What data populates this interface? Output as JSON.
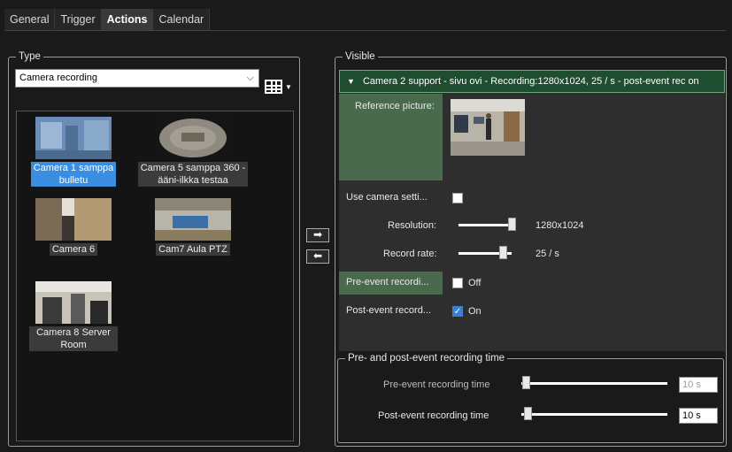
{
  "tabs": [
    "General",
    "Trigger",
    "Actions",
    "Calendar"
  ],
  "type_group": {
    "title": "Type",
    "dropdown_value": "Camera recording",
    "cameras": [
      {
        "label": "Camera 1 samppa bulletu",
        "selected": true
      },
      {
        "label": "Camera 5 samppa 360 - ääni-ilkka testaa",
        "selected": false
      },
      {
        "label": "Camera 6",
        "selected": false
      },
      {
        "label": "Cam7 Aula PTZ",
        "selected": false
      },
      {
        "label": "Camera 8 Server Room",
        "selected": false
      }
    ],
    "camera_label_lines": [
      [
        "Camera 1 samppa",
        "bulletu"
      ],
      [
        "Camera 5 samppa 360 -",
        "ääni-ilkka testaa"
      ]
    ]
  },
  "arrows": {
    "add": "➡",
    "remove": "⬅"
  },
  "visible_group": {
    "title": "Visible",
    "header": "Camera 2 support - sivu ovi - Recording:1280x1024, 25 / s - post-event rec on",
    "reference_label": "Reference picture:",
    "use_camera_settings_label": "Use camera setti...",
    "use_camera_settings_checked": false,
    "resolution_label": "Resolution:",
    "resolution_value": "1280x1024",
    "resolution_level": 1.0,
    "record_rate_label": "Record rate:",
    "record_rate_value": "25 / s",
    "record_rate_level": 0.8,
    "pre_event_label": "Pre-event recordi...",
    "pre_event_state": "Off",
    "pre_event_checked": false,
    "post_event_label": "Post-event record...",
    "post_event_state": "On",
    "post_event_checked": true
  },
  "prepost_group": {
    "title": "Pre- and post-event recording time",
    "pre_label": "Pre-event recording time",
    "pre_value": "10 s",
    "pre_level": 0.05,
    "post_label": "Post-event recording time",
    "post_value": "10 s",
    "post_level": 0.05
  },
  "colors": {
    "accent": "#3a8de0",
    "header_green": "#1f4d2f",
    "highlight_green": "#4a6a4e"
  },
  "icons": [
    "grid-layout-icon",
    "expand-triangle-icon",
    "arrow-right-icon",
    "arrow-left-icon",
    "checkmark-icon"
  ]
}
